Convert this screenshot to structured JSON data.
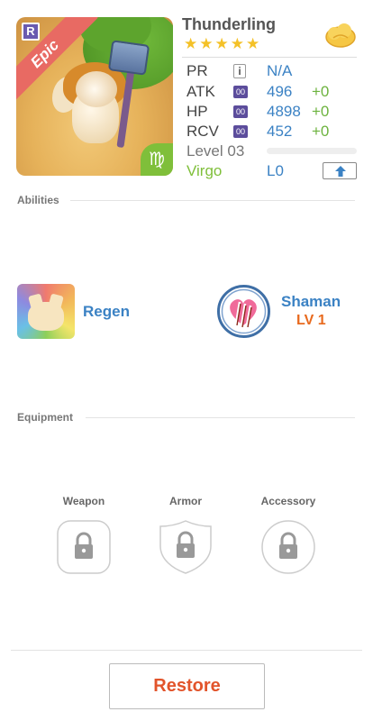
{
  "monster": {
    "name": "Thunderling",
    "stars": "★★★★★",
    "rarity": "Epic",
    "rarity_badge": "R",
    "zodiac_symbol": "♍",
    "zodiac": "Virgo"
  },
  "stats": {
    "pr": {
      "label": "PR",
      "icon": "i",
      "value": "N/A"
    },
    "atk": {
      "label": "ATK",
      "icon": "00",
      "value": "496",
      "bonus": "+0"
    },
    "hp": {
      "label": "HP",
      "icon": "00",
      "value": "4898",
      "bonus": "+0"
    },
    "rcv": {
      "label": "RCV",
      "icon": "00",
      "value": "452",
      "bonus": "+0"
    },
    "level": {
      "label": "Level 03",
      "progress": 0.0
    },
    "limit": {
      "value": "L0"
    }
  },
  "abilities": {
    "section_label": "Abilities",
    "skill": {
      "name": "Regen"
    },
    "class": {
      "name": "Shaman",
      "level": "LV 1"
    }
  },
  "equipment": {
    "section_label": "Equipment",
    "slots": [
      {
        "label": "Weapon"
      },
      {
        "label": "Armor"
      },
      {
        "label": "Accessory"
      }
    ]
  },
  "actions": {
    "restore_label": "Restore"
  },
  "colors": {
    "value_blue": "#3b82c4",
    "bonus_green": "#6db33f",
    "star_gold": "#f4c127",
    "restore_orange": "#e2542b",
    "epic_red": "#e86a63",
    "zodiac_green": "#7fbf3a"
  },
  "icons": {
    "cloud": "cloud-icon",
    "upgrade": "arrow-up-icon",
    "lock": "lock-icon",
    "class": "heart-claw-icon"
  }
}
